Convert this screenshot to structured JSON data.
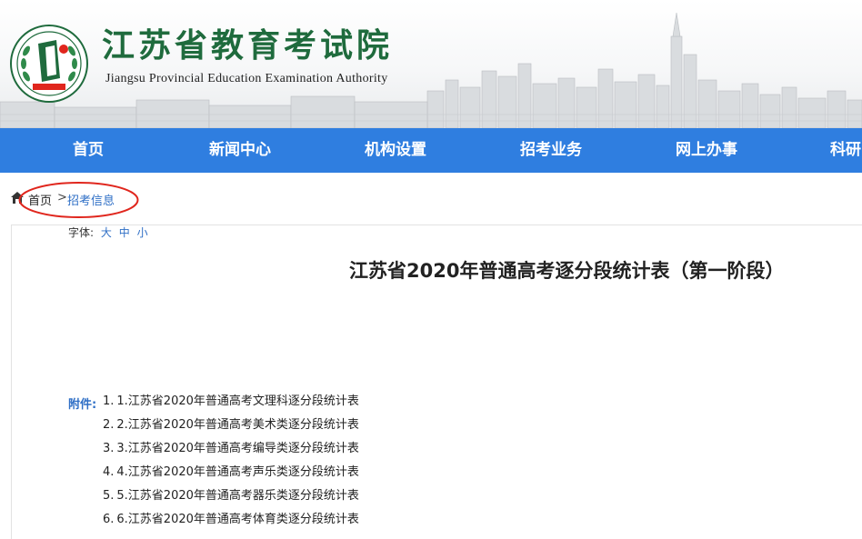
{
  "header": {
    "logo_text": "江苏省教育考试院",
    "title": "江苏省教育考试院",
    "subtitle": "Jiangsu Provincial Education Examination Authority",
    "brand_color": "#1f6b3d"
  },
  "nav": {
    "items": [
      "首页",
      "新闻中心",
      "机构设置",
      "招考业务",
      "网上办事",
      "科研"
    ],
    "background": "#2f7ee0"
  },
  "breadcrumb": {
    "home": "首页",
    "separator": ">",
    "current": "招考信息"
  },
  "article": {
    "font_size_label": "字体:",
    "font_sizes": [
      "大",
      "中",
      "小"
    ],
    "title": "江苏省2020年普通高考逐分段统计表（第一阶段）",
    "attachments_label": "附件:",
    "attachments": [
      {
        "num": "1.",
        "label": "1.江苏省2020年普通高考文理科逐分段统计表"
      },
      {
        "num": "2.",
        "label": "2.江苏省2020年普通高考美术类逐分段统计表"
      },
      {
        "num": "3.",
        "label": "3.江苏省2020年普通高考编导类逐分段统计表"
      },
      {
        "num": "4.",
        "label": "4.江苏省2020年普通高考声乐类逐分段统计表"
      },
      {
        "num": "5.",
        "label": "5.江苏省2020年普通高考器乐类逐分段统计表"
      },
      {
        "num": "6.",
        "label": "6.江苏省2020年普通高考体育类逐分段统计表"
      }
    ]
  },
  "colors": {
    "link": "#2f6fc6",
    "annotation": "#e0261d"
  }
}
